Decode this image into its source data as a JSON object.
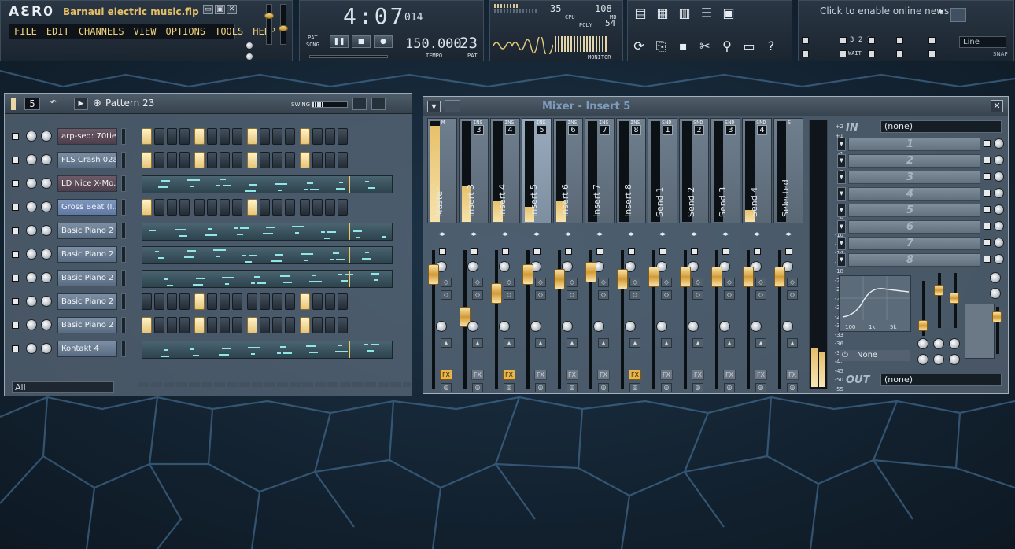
{
  "app": {
    "logo": "AƐR0",
    "project_title": "Barnaul electric music.flp",
    "window_buttons": [
      "▭",
      "▣",
      "✕"
    ]
  },
  "menu": [
    "FILE",
    "EDIT",
    "CHANNELS",
    "VIEW",
    "OPTIONS",
    "TOOLS",
    "HELP"
  ],
  "transport": {
    "time_display": "4:07",
    "time_frac": "014",
    "pat_label": "PAT",
    "song_label": "SONG",
    "tempo": "150.000",
    "tempo_label": "TEMPO",
    "pattern_number": "23",
    "pattern_label": "PAT",
    "counter": "108",
    "counter_unit": "MB",
    "poly": "54",
    "poly_label": "POLY",
    "cpu_label": "CPU",
    "meter_top": "35",
    "monitor_label": "MONITOR"
  },
  "news": {
    "text": "Click to enable online news"
  },
  "snap": {
    "value": "Line",
    "label": "SNAP",
    "wait_label": "WAIT",
    "count_label": "3 2 1"
  },
  "channel_rack": {
    "pattern_number": "5",
    "pattern_name": "Pattern 23",
    "swing_label": "SWING",
    "swing": 0.3,
    "filter": "All",
    "channels": [
      {
        "name": "arp-seq: 70tie...",
        "style": "dark",
        "mode": "steps",
        "steps": [
          1,
          0,
          0,
          0,
          1,
          0,
          0,
          0,
          1,
          0,
          0,
          0,
          1,
          0,
          0,
          0
        ]
      },
      {
        "name": "FLS Crash 02a",
        "style": "plain",
        "mode": "steps",
        "steps": [
          1,
          0,
          0,
          0,
          1,
          0,
          0,
          0,
          1,
          0,
          0,
          0,
          1,
          0,
          0,
          0
        ]
      },
      {
        "name": "LD Nice X-Mo...",
        "style": "dark",
        "mode": "roll"
      },
      {
        "name": "Gross Beat (I...",
        "style": "blue",
        "mode": "steps",
        "steps": [
          1,
          0,
          0,
          0,
          0,
          0,
          0,
          0,
          1,
          0,
          0,
          0,
          0,
          0,
          0,
          0
        ]
      },
      {
        "name": "Basic Piano 2",
        "style": "plain",
        "mode": "roll"
      },
      {
        "name": "Basic Piano 2 ...",
        "style": "plain",
        "mode": "roll"
      },
      {
        "name": "Basic Piano 2 ...",
        "style": "plain",
        "mode": "roll"
      },
      {
        "name": "Basic Piano 2 ...",
        "style": "plain",
        "mode": "steps",
        "steps": [
          0,
          0,
          0,
          0,
          1,
          0,
          0,
          0,
          0,
          0,
          0,
          0,
          1,
          0,
          0,
          0
        ]
      },
      {
        "name": "Basic Piano 2 ...",
        "style": "plain",
        "mode": "steps",
        "steps": [
          1,
          0,
          0,
          0,
          1,
          0,
          0,
          0,
          1,
          0,
          0,
          0,
          1,
          0,
          0,
          0
        ]
      },
      {
        "name": "Kontakt 4",
        "style": "plain",
        "mode": "roll"
      }
    ]
  },
  "mixer": {
    "title": "Mixer - Insert 5",
    "in_label": "IN",
    "in_value": "(none)",
    "out_label": "OUT",
    "out_value": "(none)",
    "eq_preset": "None",
    "eq_freqs": [
      "100",
      "1k",
      "5k"
    ],
    "slots": [
      "1",
      "2",
      "3",
      "4",
      "5",
      "6",
      "7",
      "8"
    ],
    "db_scale": [
      "+2",
      "+1",
      "0",
      "-1",
      "-2",
      "-3",
      "-4",
      "-5",
      "-6",
      "-7",
      "-8",
      "-9",
      "-10",
      "-12",
      "-14",
      "-16",
      "-18",
      "-20",
      "-22",
      "-24",
      "-26",
      "-28",
      "-30",
      "-33",
      "-36",
      "-39",
      "-42",
      "-45",
      "-50",
      "-55"
    ],
    "strips": [
      {
        "name": "Master",
        "tag": "M",
        "num": "",
        "level": 0.95,
        "fader": 0.12,
        "fx": true,
        "selected": false
      },
      {
        "name": "Insert 3",
        "tag": "INS",
        "num": "3",
        "level": 0.35,
        "fader": 0.48,
        "fx": false,
        "selected": false
      },
      {
        "name": "Insert 4",
        "tag": "INS",
        "num": "4",
        "level": 0.2,
        "fader": 0.28,
        "fx": true,
        "selected": false
      },
      {
        "name": "Insert 5",
        "tag": "INS",
        "num": "5",
        "level": 0.15,
        "fader": 0.12,
        "fx": false,
        "selected": true
      },
      {
        "name": "Insert 6",
        "tag": "INS",
        "num": "6",
        "level": 0.2,
        "fader": 0.16,
        "fx": false,
        "selected": false
      },
      {
        "name": "Insert 7",
        "tag": "INS",
        "num": "7",
        "level": 0.0,
        "fader": 0.1,
        "fx": false,
        "selected": false
      },
      {
        "name": "Insert 8",
        "tag": "INS",
        "num": "8",
        "level": 0.0,
        "fader": 0.16,
        "fx": true,
        "selected": false
      },
      {
        "name": "Send 1",
        "tag": "SND",
        "num": "1",
        "level": 0.0,
        "fader": 0.14,
        "fx": false,
        "selected": false
      },
      {
        "name": "Send 2",
        "tag": "SND",
        "num": "2",
        "level": 0.0,
        "fader": 0.14,
        "fx": false,
        "selected": false
      },
      {
        "name": "Send 3",
        "tag": "SND",
        "num": "3",
        "level": 0.0,
        "fader": 0.14,
        "fx": false,
        "selected": false
      },
      {
        "name": "Send 4",
        "tag": "SND",
        "num": "4",
        "level": 0.12,
        "fader": 0.14,
        "fx": false,
        "selected": false
      },
      {
        "name": "Selected",
        "tag": "S",
        "num": "",
        "level": 0.0,
        "fader": 0.14,
        "fx": false,
        "selected": false
      }
    ]
  }
}
